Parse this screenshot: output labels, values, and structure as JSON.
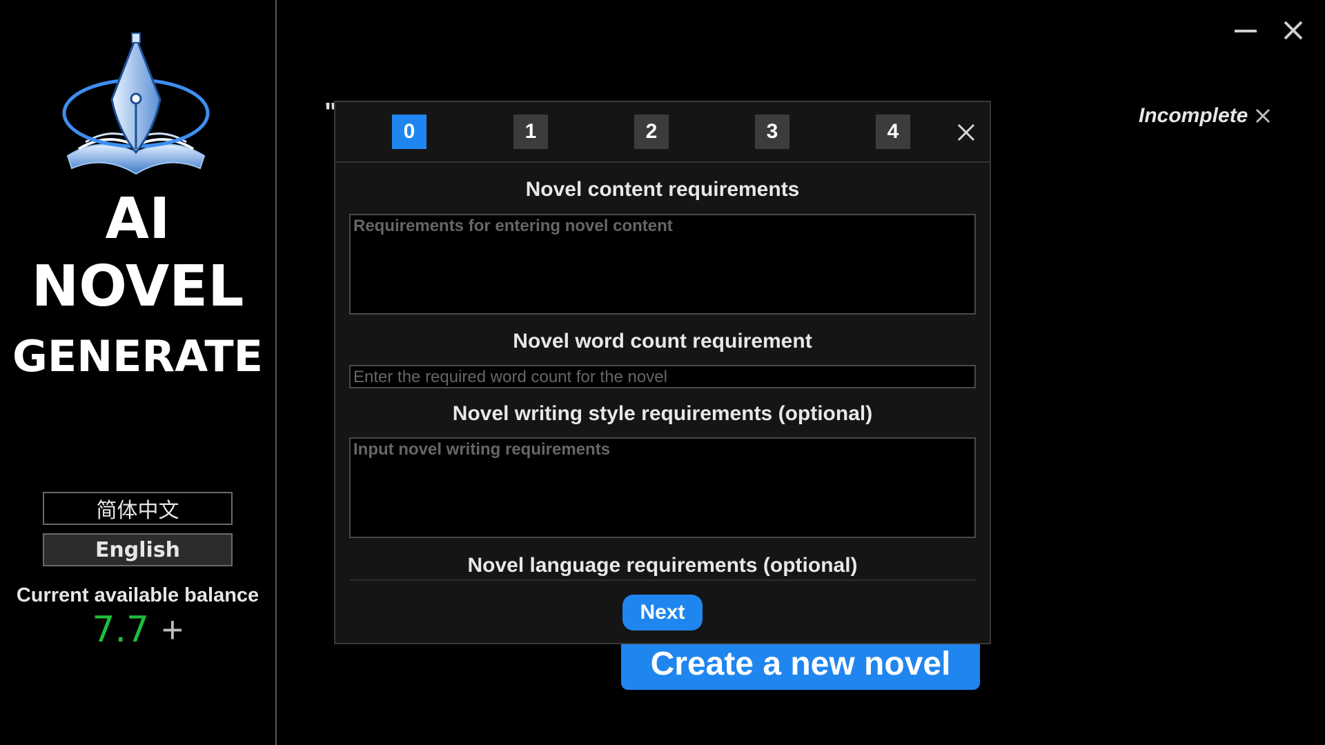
{
  "brand": {
    "line1": "AI",
    "line2": "NOVEL",
    "line3": "GENERATE"
  },
  "languages": {
    "chinese": "简体中文",
    "english": "English"
  },
  "balance": {
    "label": "Current available balance",
    "value": "7.7",
    "add_symbol": "+"
  },
  "status": {
    "text": "Incomplete"
  },
  "main": {
    "quote_mark": "\"",
    "create_button": "Create a new novel"
  },
  "modal": {
    "steps": [
      "0",
      "1",
      "2",
      "3",
      "4"
    ],
    "active_step": 0,
    "fields": {
      "content": {
        "title": "Novel content requirements",
        "placeholder": "Requirements for entering novel content"
      },
      "word_count": {
        "title": "Novel word count requirement",
        "placeholder": "Enter the required word count for the novel"
      },
      "style": {
        "title": "Novel writing style requirements (optional)",
        "placeholder": "Input novel writing requirements"
      },
      "language": {
        "title": "Novel language requirements (optional)"
      }
    },
    "next_button": "Next"
  },
  "colors": {
    "accent": "#1f86f0",
    "balance_green": "#1fbe3a",
    "background": "#000000",
    "modal_bg": "#151515"
  },
  "icons": {
    "logo": "pen-nib-book-logo",
    "minimize": "minimize-icon",
    "close": "close-icon",
    "add": "plus-icon"
  }
}
